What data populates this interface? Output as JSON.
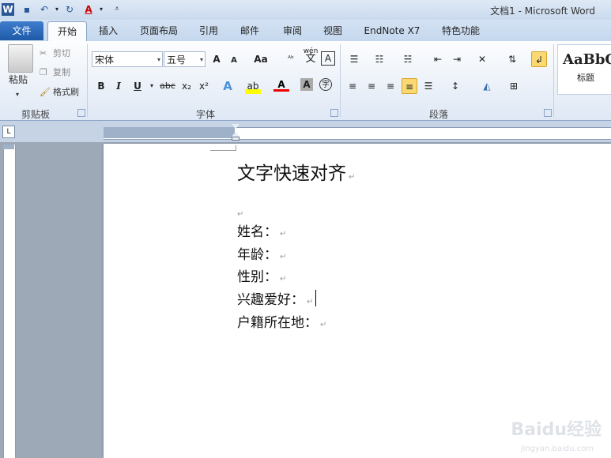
{
  "window": {
    "title": "文档1 - Microsoft Word"
  },
  "tabs": [
    {
      "label": "文件"
    },
    {
      "label": "开始"
    },
    {
      "label": "插入"
    },
    {
      "label": "页面布局"
    },
    {
      "label": "引用"
    },
    {
      "label": "邮件"
    },
    {
      "label": "审阅"
    },
    {
      "label": "视图"
    },
    {
      "label": "EndNote X7"
    },
    {
      "label": "特色功能"
    }
  ],
  "clipboard": {
    "paste": "粘贴",
    "cut": "剪切",
    "copy": "复制",
    "format_painter": "格式刷",
    "group": "剪贴板"
  },
  "font": {
    "name": "宋体",
    "size": "五号",
    "group": "字体",
    "grow": "A",
    "shrink": "A",
    "case": "Aa",
    "bold": "B",
    "italic": "I",
    "underline": "U",
    "strike": "abc",
    "sub": "x₂",
    "sup": "x²",
    "wen": "wén",
    "wen_char": "文"
  },
  "paragraph": {
    "group": "段落"
  },
  "styles": {
    "sample": "AaBbC",
    "name": "标题"
  },
  "document": {
    "title": "文字快速对齐",
    "lines": [
      "姓名：",
      "年龄：",
      "性别：",
      "兴趣爱好：",
      "户籍所在地："
    ]
  },
  "watermark": {
    "brand": "Baidu经验",
    "url": "jingyan.baidu.com"
  },
  "colors": {
    "accent": "#1e5aa8",
    "highlight": "#fbd972"
  }
}
